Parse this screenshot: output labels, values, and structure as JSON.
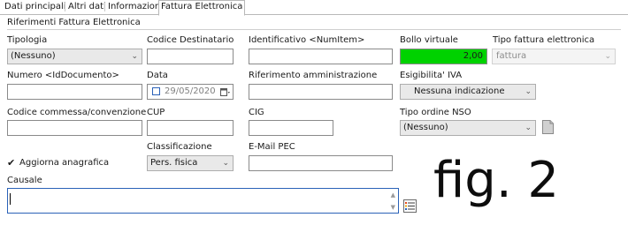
{
  "tabs": [
    "Dati principali",
    "Altri dati",
    "Informazioni",
    "Fattura Elettronica"
  ],
  "section_title": "Riferimenti Fattura Elettronica",
  "fields": {
    "tipologia": {
      "label": "Tipologia",
      "value": "(Nessuno)"
    },
    "codice_destinatario": {
      "label": "Codice Destinatario",
      "value": ""
    },
    "identificativo": {
      "label": "Identificativo <NumItem>",
      "value": ""
    },
    "bollo_virtuale": {
      "label": "Bollo virtuale",
      "value": "2,00"
    },
    "tipo_fattura": {
      "label": "Tipo fattura elettronica",
      "value": "fattura"
    },
    "numero": {
      "label": "Numero <IdDocumento>",
      "value": ""
    },
    "data": {
      "label": "Data",
      "value": "29/05/2020"
    },
    "riferimento_amministrazione": {
      "label": "Riferimento amministrazione",
      "value": ""
    },
    "esigibilita_iva": {
      "label": "Esigibilita' IVA",
      "value": "Nessuna indicazione"
    },
    "codice_commessa": {
      "label": "Codice commessa/convenzione",
      "value": ""
    },
    "cup": {
      "label": "CUP",
      "value": ""
    },
    "cig": {
      "label": "CIG",
      "value": ""
    },
    "tipo_ordine_nso": {
      "label": "Tipo ordine NSO",
      "value": "(Nessuno)"
    },
    "aggiorna_anagrafica": {
      "label": "Aggiorna anagrafica",
      "checked": true
    },
    "classificazione": {
      "label": "Classificazione",
      "value": "Pers. fisica"
    },
    "email_pec": {
      "label": "E-Mail PEC",
      "value": ""
    },
    "causale": {
      "label": "Causale",
      "value": ""
    }
  },
  "annotation": "fig. 2",
  "colors": {
    "bollo_bg": "#00d200",
    "focus_border": "#2b62b8",
    "tab_border": "#b8b8b8"
  },
  "icons": [
    "chevron-down-icon",
    "calendar-icon",
    "document-icon",
    "list-picker-icon"
  ]
}
